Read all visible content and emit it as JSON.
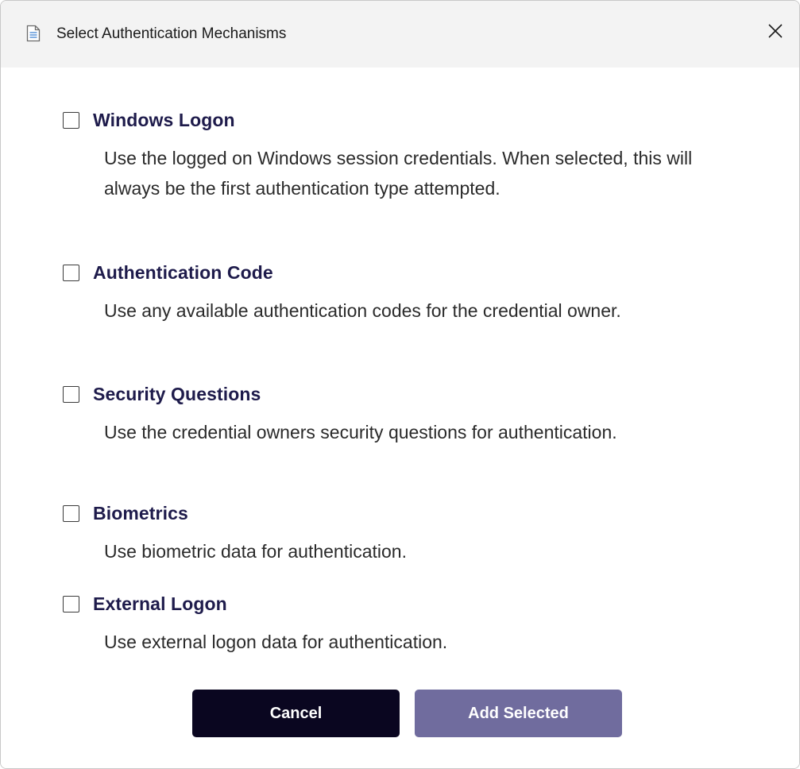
{
  "window": {
    "title": "Select Authentication Mechanisms",
    "icon": "document-icon",
    "close_icon": "close-icon"
  },
  "options": [
    {
      "label": "Windows Logon",
      "description": "Use the logged on Windows session credentials. When selected, this will always be the first authentication type attempted.",
      "checked": false
    },
    {
      "label": "Authentication Code",
      "description": "Use any available authentication codes for the credential owner.",
      "checked": false
    },
    {
      "label": "Security Questions",
      "description": "Use the credential owners security questions for authentication.",
      "checked": false
    },
    {
      "label": "Biometrics",
      "description": "Use biometric data for authentication.",
      "checked": false
    },
    {
      "label": "External Logon",
      "description": "Use external logon data for authentication.",
      "checked": false
    }
  ],
  "buttons": {
    "cancel_label": "Cancel",
    "add_label": "Add Selected"
  },
  "colors": {
    "option_title": "#1e1b4b",
    "cancel_bg": "#0a0620",
    "add_bg": "#706c9e",
    "titlebar_bg": "#f3f3f3"
  }
}
